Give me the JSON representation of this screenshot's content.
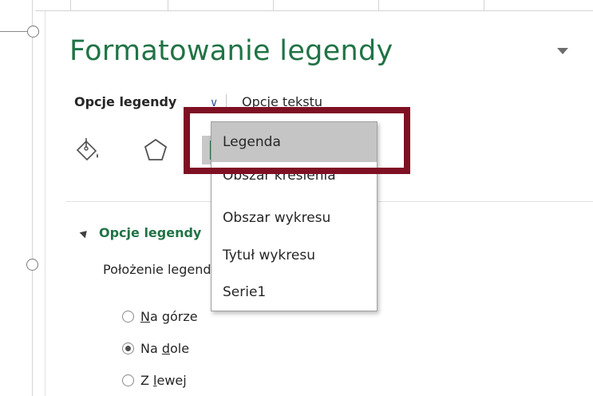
{
  "pane": {
    "title": "Formatowanie legendy"
  },
  "tabs": {
    "legend_options": "Opcje legendy",
    "text_options": "Opcje tekstu"
  },
  "icons": {
    "fill": "paint-bucket-icon",
    "effects": "pentagon-icon",
    "size": "size-properties-icon"
  },
  "section": {
    "header": "Opcje legendy",
    "position_label": "Położenie legendy"
  },
  "radios": [
    {
      "pre": "",
      "u": "N",
      "post": "a górze",
      "checked": false
    },
    {
      "pre": "Na ",
      "u": "d",
      "post": "ole",
      "checked": true
    },
    {
      "pre": "Z ",
      "u": "l",
      "post": "ewej",
      "checked": false
    }
  ],
  "dropdown": {
    "items": [
      "Legenda",
      "Obszar kreślenia",
      "Obszar wykresu",
      "Tytuł wykresu",
      "Serie1"
    ],
    "selected": "Legenda"
  },
  "colors": {
    "accent": "#217346",
    "highlight": "#7f1024",
    "selected_bg": "#c5c5c5"
  }
}
